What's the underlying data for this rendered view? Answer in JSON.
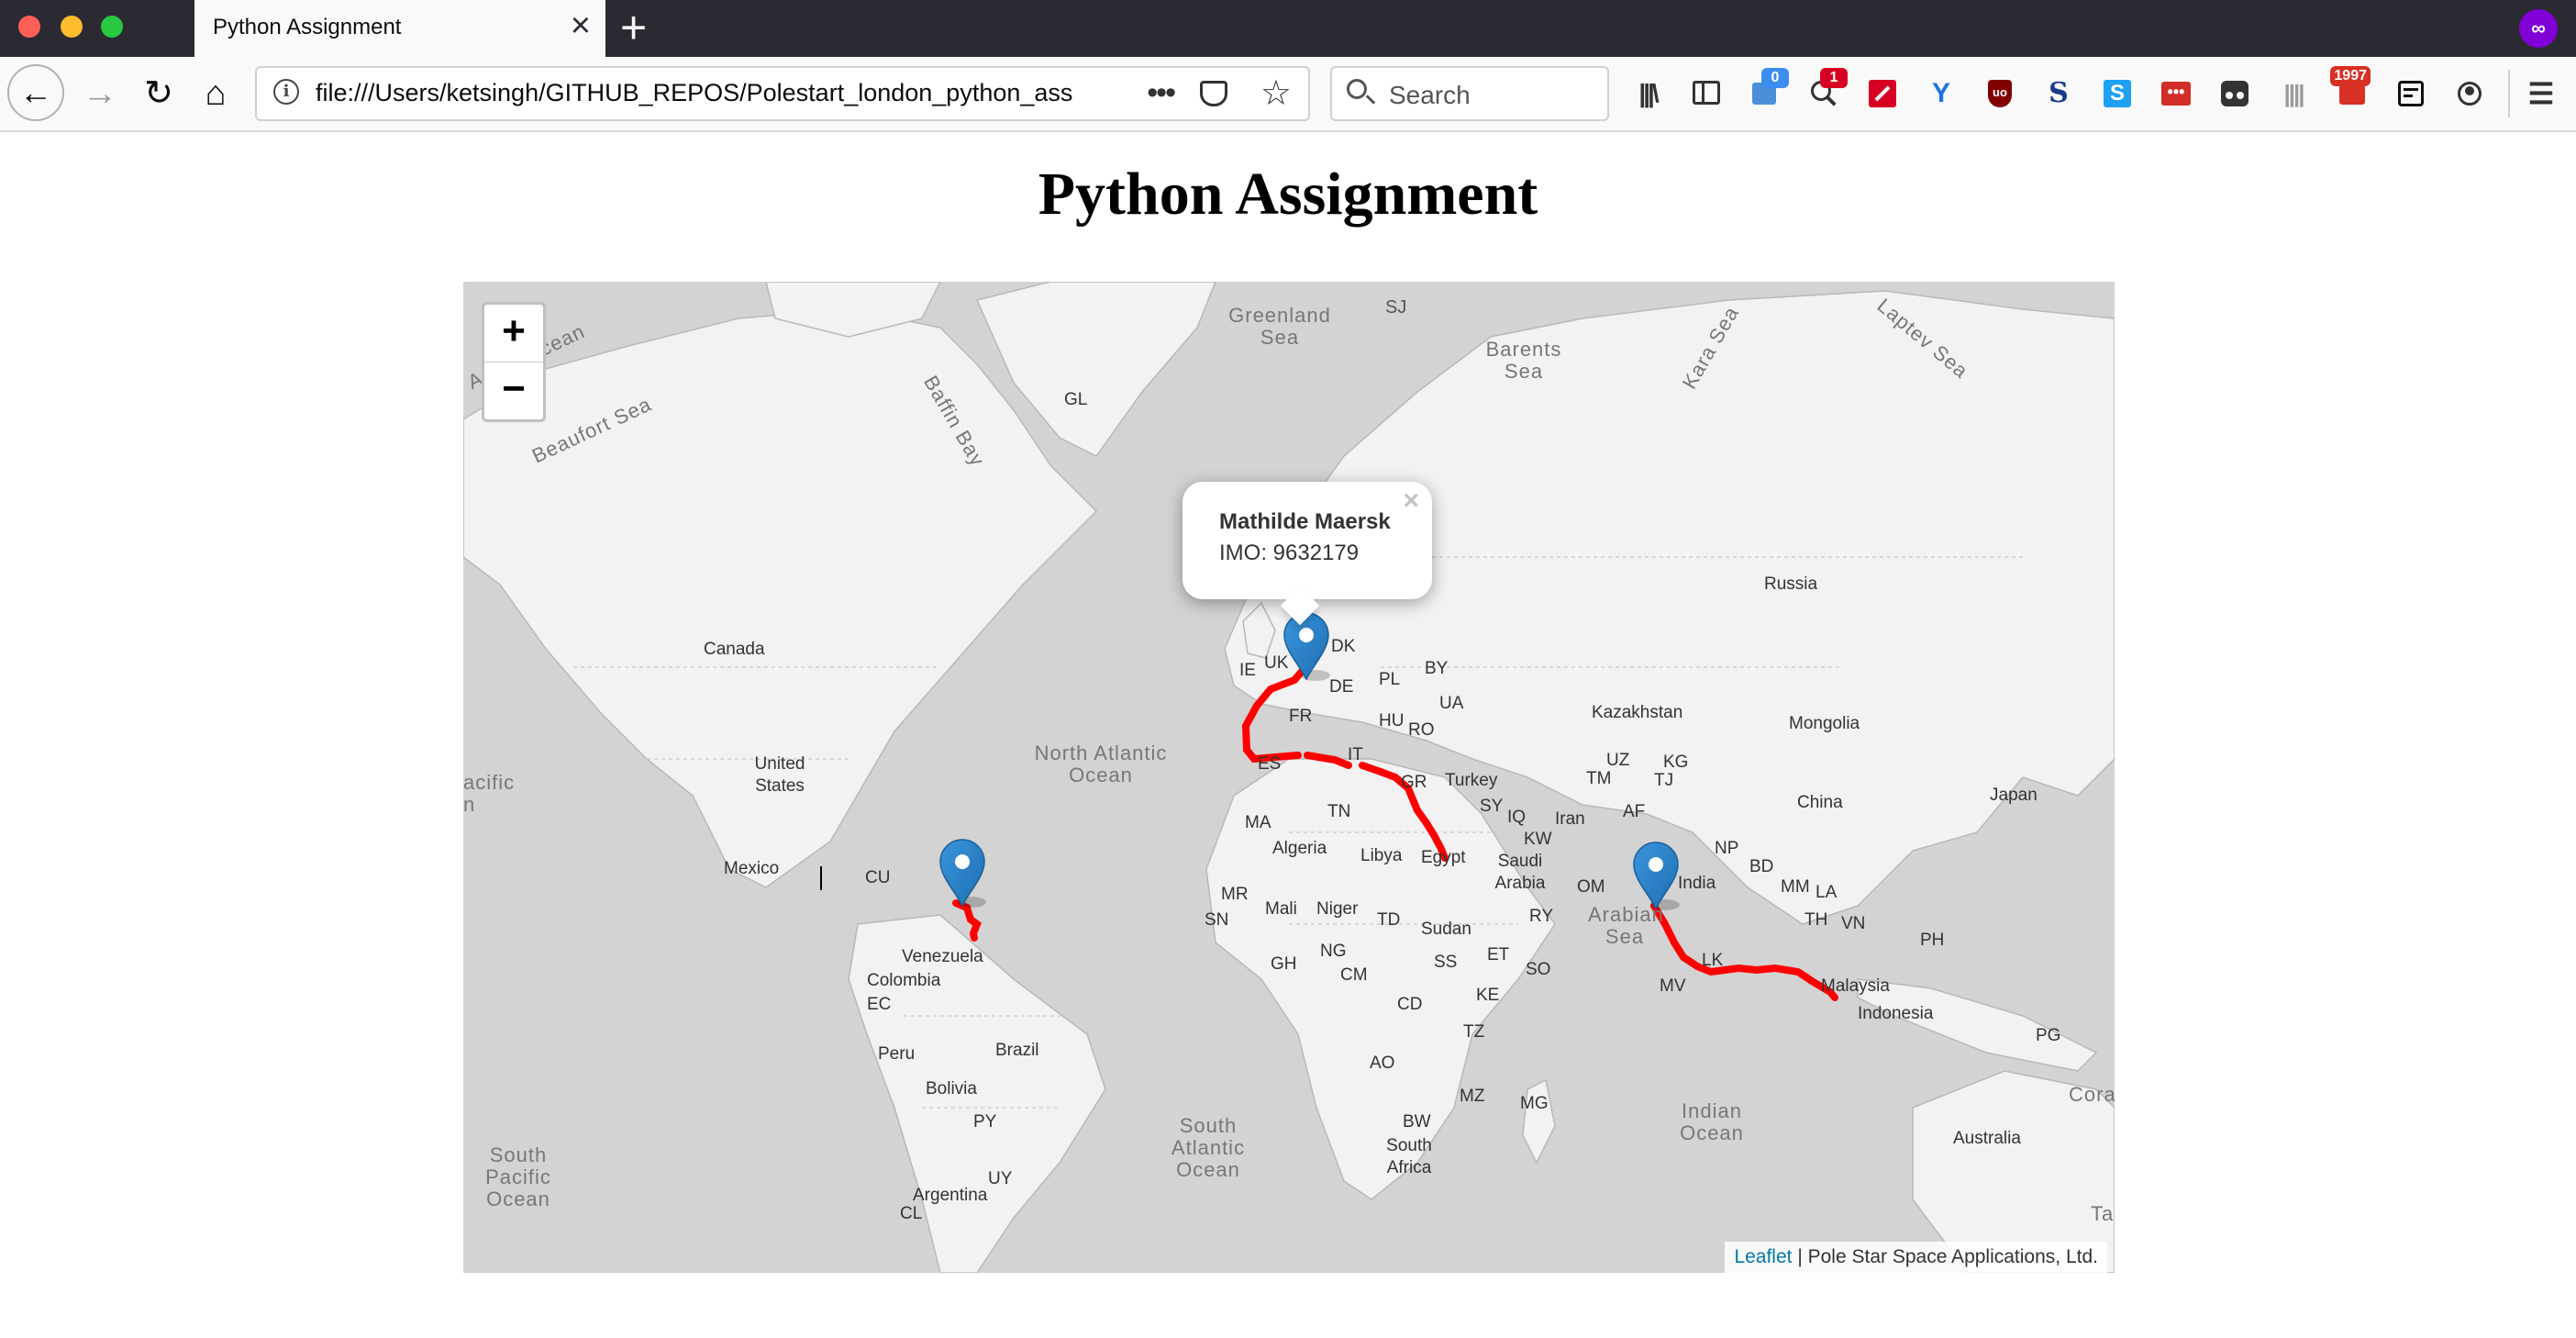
{
  "browser": {
    "tab_title": "Python Assignment",
    "tab_close": "×",
    "new_tab": "+",
    "url": "file:///Users/ketsingh/GITHUB_REPOS/Polestart_london_python_ass",
    "url_more": "•••",
    "search_placeholder": "Search",
    "privacy_mask": "∞",
    "badges": {
      "screenshot": "0",
      "zoom_search": "1",
      "mail": "1997"
    },
    "extension_letters": {
      "stylus": "S",
      "simplenote": "S"
    }
  },
  "page": {
    "title": "Python Assignment"
  },
  "map": {
    "zoom_in": "+",
    "zoom_out": "−",
    "popup": {
      "name": "Mathilde Maersk",
      "imo": "IMO: 9632179",
      "close": "×"
    },
    "attribution": {
      "leaflet": "Leaflet",
      "separator": " | ",
      "owner": "Pole Star Space Applications, Ltd."
    },
    "route_color": "#ff0000",
    "marker_color": "#2a81cb",
    "labels": {
      "greenland_sea": "Greenland Sea",
      "sj": "SJ",
      "barents_sea": "Barents Sea",
      "kara_sea": "Kara Sea",
      "laptev_sea": "Laptev Sea",
      "arctic_ocean": "Arctic Ocean",
      "baffin_bay": "Baffin Bay",
      "gl": "GL",
      "beaufort_sea": "Beaufort Sea",
      "canada": "Canada",
      "russia": "Russia",
      "uk": "UK",
      "ie": "IE",
      "dk": "DK",
      "pl": "PL",
      "by": "BY",
      "de": "DE",
      "fr": "FR",
      "ua": "UA",
      "hu": "HU",
      "ro": "RO",
      "kazakhstan": "Kazakhstan",
      "mongolia": "Mongolia",
      "es": "ES",
      "it": "IT",
      "gr": "GR",
      "turkey": "Turkey",
      "uz": "UZ",
      "kg": "KG",
      "tm": "TM",
      "tj": "TJ",
      "united_states": "United States",
      "north_atlantic_ocean": "North Atlantic Ocean",
      "pacific": "acific",
      "pacific_n": "n",
      "china": "China",
      "japan": "Japan",
      "tn": "TN",
      "sy": "SY",
      "iq": "IQ",
      "iran": "Iran",
      "af": "AF",
      "ma": "MA",
      "kw": "KW",
      "mexico": "Mexico",
      "cu": "CU",
      "algeria": "Algeria",
      "libya": "Libya",
      "egypt": "Egypt",
      "saudi_arabia": "Saudi Arabia",
      "np": "NP",
      "bd": "BD",
      "mm": "MM",
      "la": "LA",
      "india": "India",
      "om": "OM",
      "th": "TH",
      "vn": "VN",
      "mr": "MR",
      "mali": "Mali",
      "niger": "Niger",
      "td": "TD",
      "sudan": "Sudan",
      "ry": "RY",
      "arabian_sea": "Arabian Sea",
      "ph": "PH",
      "sn": "SN",
      "venezuela": "Venezuela",
      "ng": "NG",
      "et": "ET",
      "colombia": "Colombia",
      "gh": "GH",
      "cm": "CM",
      "ss": "SS",
      "so": "SO",
      "lk": "LK",
      "mv": "MV",
      "malaysia": "Malaysia",
      "ec": "EC",
      "ke": "KE",
      "indonesia": "Indonesia",
      "cd": "CD",
      "peru": "Peru",
      "brazil": "Brazil",
      "tz": "TZ",
      "pg": "PG",
      "ao": "AO",
      "bolivia": "Bolivia",
      "mz": "MZ",
      "mg": "MG",
      "coral": "Coral",
      "py": "PY",
      "bw": "BW",
      "indian_ocean": "Indian Ocean",
      "south_atlantic_ocean": "South Atlantic Ocean",
      "south_africa": "South Africa",
      "australia": "Australia",
      "south_pacific_ocean": "South Pacific Ocean",
      "uy": "UY",
      "argentina": "Argentina",
      "cl": "CL",
      "ta": "Ta"
    }
  }
}
